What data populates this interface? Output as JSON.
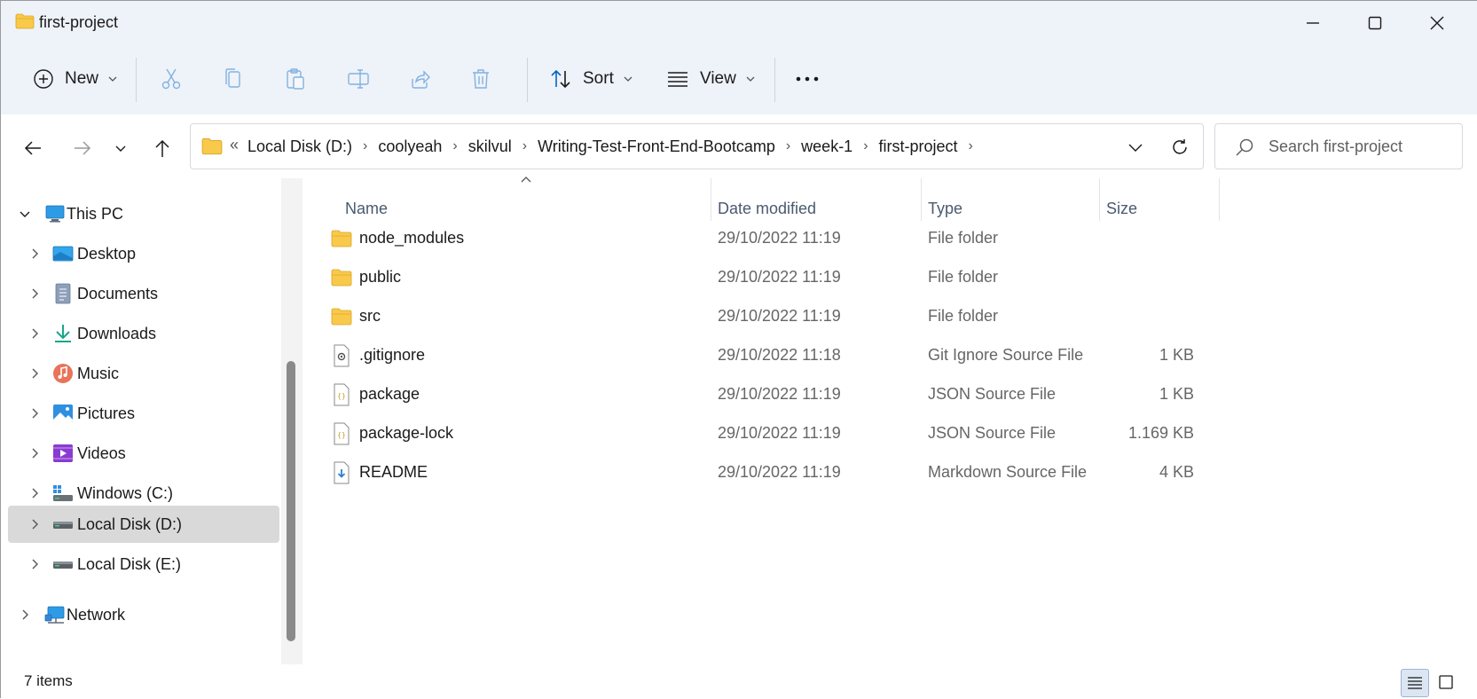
{
  "window": {
    "title": "first-project"
  },
  "commandbar": {
    "new_label": "New",
    "sort_label": "Sort",
    "view_label": "View"
  },
  "address": {
    "overflow_label": "«",
    "crumbs": [
      "Local Disk (D:)",
      "coolyeah",
      "skilvul",
      "Writing-Test-Front-End-Bootcamp",
      "week-1",
      "first-project"
    ]
  },
  "search": {
    "placeholder": "Search first-project"
  },
  "sidebar": {
    "items": [
      {
        "label": "This PC",
        "icon": "this-pc-icon"
      },
      {
        "label": "Desktop",
        "icon": "desktop-icon"
      },
      {
        "label": "Documents",
        "icon": "documents-icon"
      },
      {
        "label": "Downloads",
        "icon": "downloads-icon"
      },
      {
        "label": "Music",
        "icon": "music-icon"
      },
      {
        "label": "Pictures",
        "icon": "pictures-icon"
      },
      {
        "label": "Videos",
        "icon": "videos-icon"
      },
      {
        "label": "Windows (C:)",
        "icon": "drive-c-icon"
      },
      {
        "label": "Local Disk (D:)",
        "icon": "drive-icon",
        "selected": true
      },
      {
        "label": "Local Disk (E:)",
        "icon": "drive-icon"
      },
      {
        "label": "Network",
        "icon": "network-icon"
      }
    ]
  },
  "columns": {
    "name": "Name",
    "date": "Date modified",
    "type": "Type",
    "size": "Size"
  },
  "files": [
    {
      "name": "node_modules",
      "date": "29/10/2022 11:19",
      "type": "File folder",
      "size": "",
      "icon": "folder-icon"
    },
    {
      "name": "public",
      "date": "29/10/2022 11:19",
      "type": "File folder",
      "size": "",
      "icon": "folder-icon"
    },
    {
      "name": "src",
      "date": "29/10/2022 11:19",
      "type": "File folder",
      "size": "",
      "icon": "folder-icon"
    },
    {
      "name": ".gitignore",
      "date": "29/10/2022 11:18",
      "type": "Git Ignore Source File",
      "size": "1 KB",
      "icon": "settings-file-icon"
    },
    {
      "name": "package",
      "date": "29/10/2022 11:19",
      "type": "JSON Source File",
      "size": "1 KB",
      "icon": "json-file-icon"
    },
    {
      "name": "package-lock",
      "date": "29/10/2022 11:19",
      "type": "JSON Source File",
      "size": "1.169 KB",
      "icon": "json-file-icon"
    },
    {
      "name": "README",
      "date": "29/10/2022 11:19",
      "type": "Markdown Source File",
      "size": "4 KB",
      "icon": "markdown-file-icon"
    }
  ],
  "status": {
    "item_count": "7 items"
  },
  "colors": {
    "accent": "#0067c0",
    "folder": "#f8c94a",
    "chrome_bg": "#eef2f9"
  }
}
